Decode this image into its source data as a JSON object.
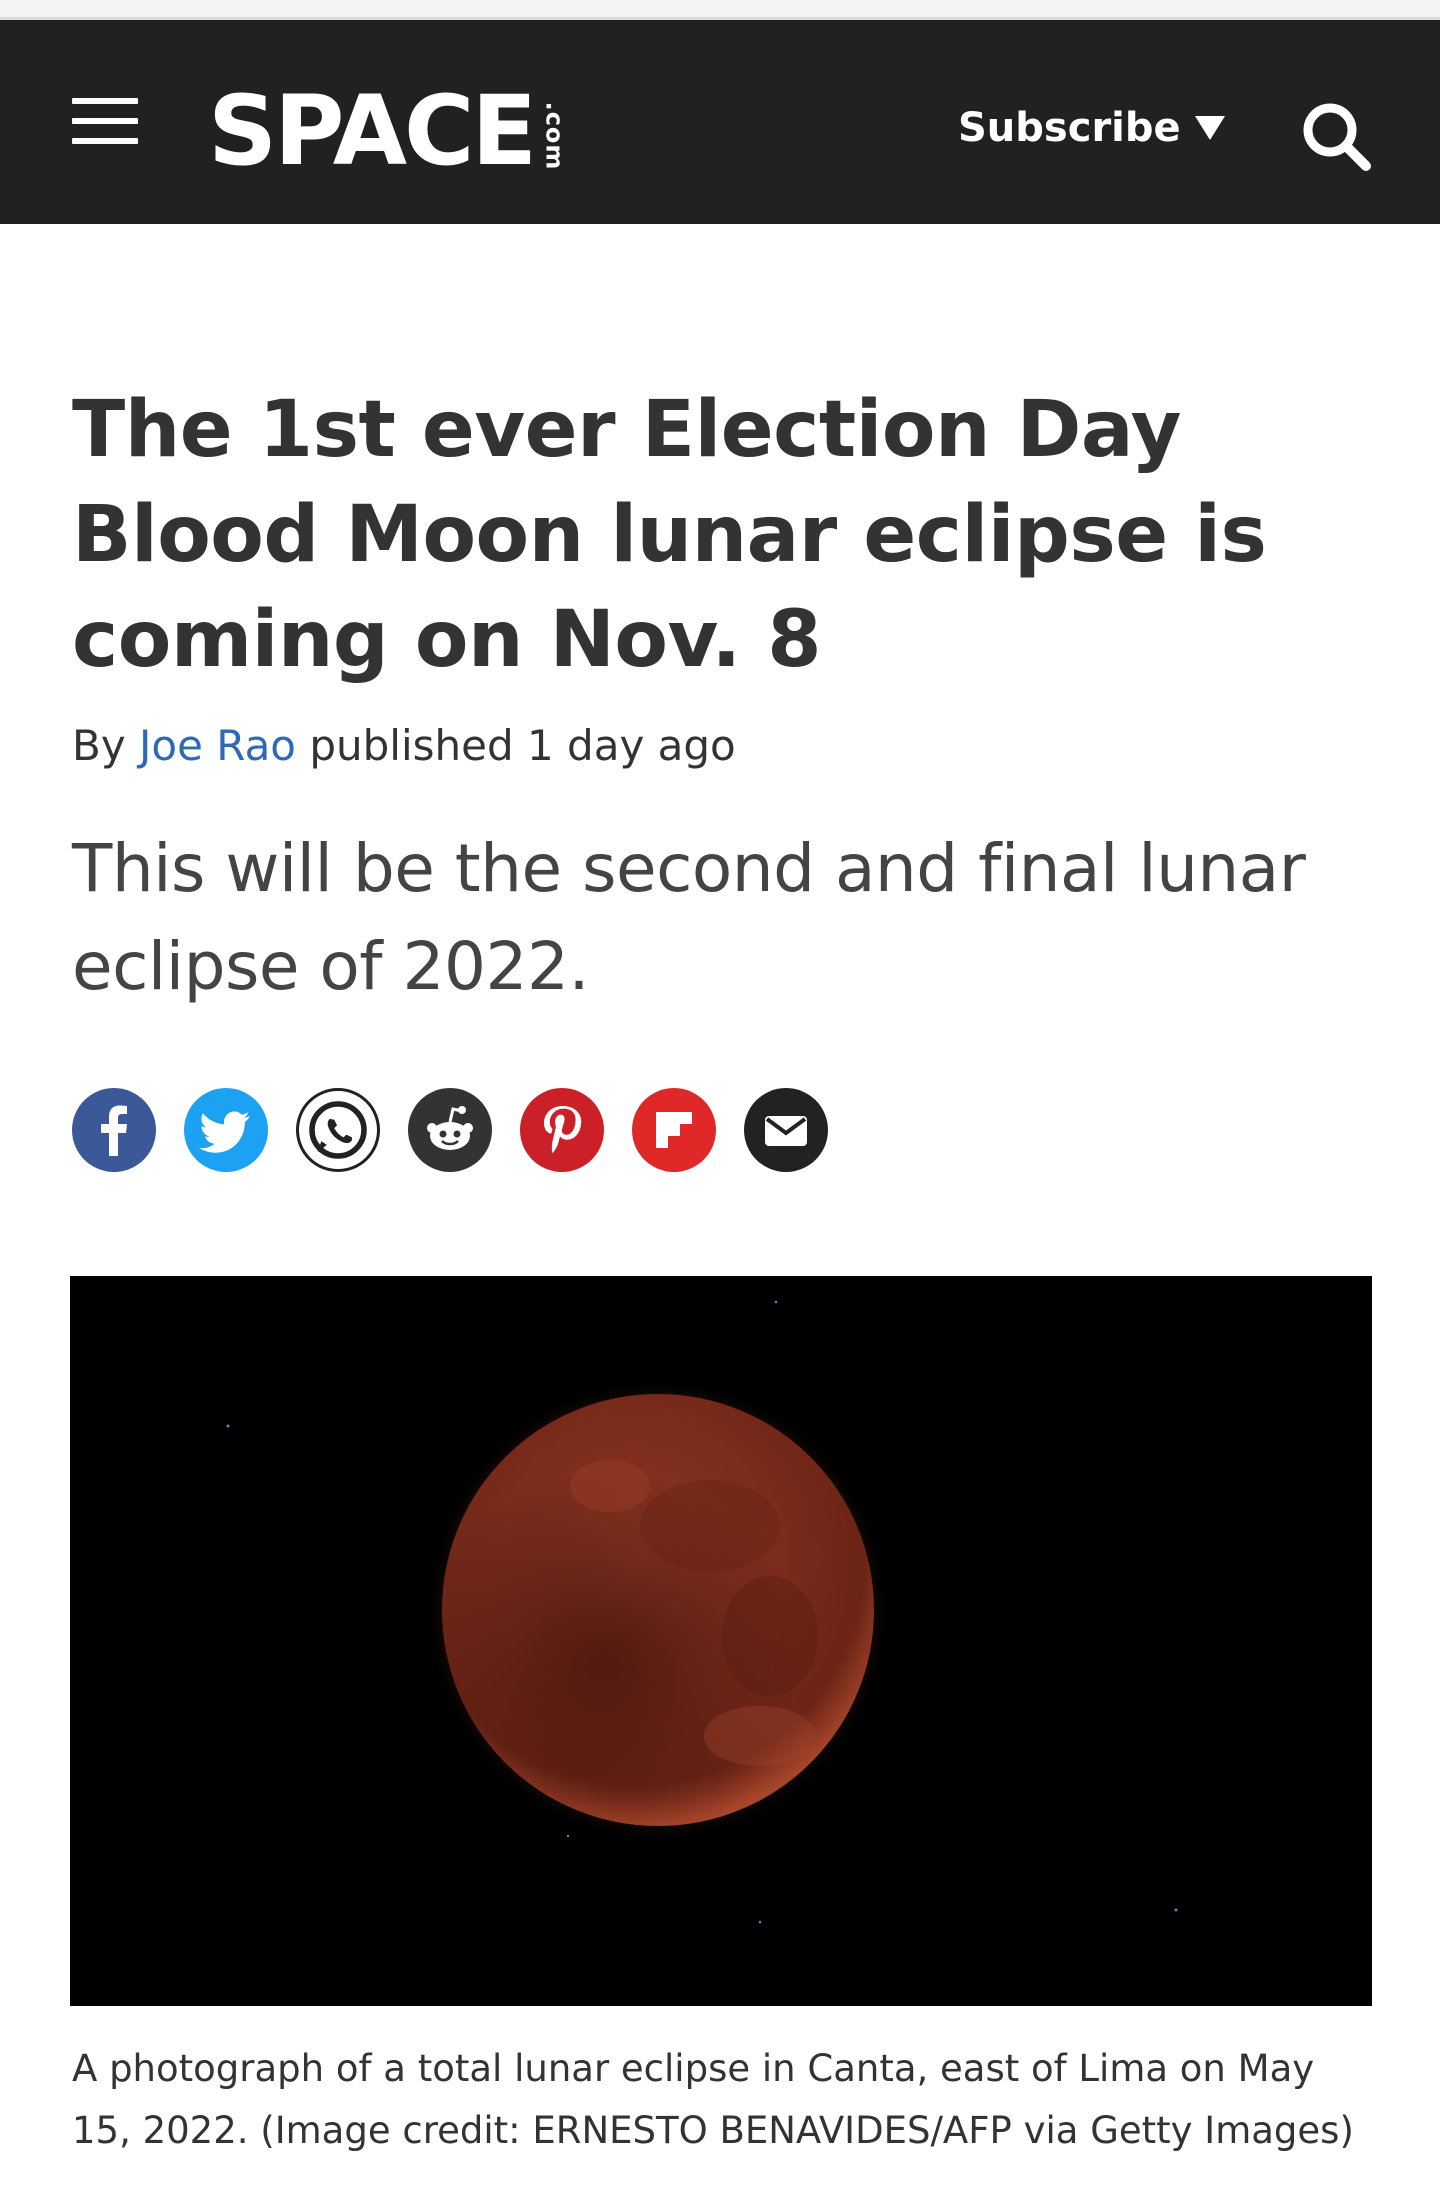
{
  "header": {
    "menu_icon": "hamburger-menu-icon",
    "logo_text": "SPACE",
    "logo_suffix": ".com",
    "subscribe_label": "Subscribe",
    "search_icon": "search-icon",
    "background": "#212121"
  },
  "article": {
    "headline": "The 1st ever Election Day Blood Moon lunar eclipse is coming on Nov. 8",
    "byline_prefix": "By",
    "author": "Joe Rao",
    "published": "published 1 day ago",
    "standfirst": "This will be the second and final lunar eclipse of 2022.",
    "share_buttons": [
      {
        "icon": "facebook-icon",
        "color": "#3b5998"
      },
      {
        "icon": "twitter-icon",
        "color": "#1da1f2"
      },
      {
        "icon": "whatsapp-icon",
        "color": "#ffffff"
      },
      {
        "icon": "reddit-icon",
        "color": "#333333"
      },
      {
        "icon": "pinterest-icon",
        "color": "#cb2027"
      },
      {
        "icon": "flipboard-icon",
        "color": "#e12828"
      },
      {
        "icon": "email-icon",
        "color": "#222222"
      }
    ],
    "caption": "A photograph of a total lunar eclipse in Canta, east of Lima on May 15, 2022.",
    "credit": "(Image credit: ERNESTO BENAVIDES/AFP via Getty Images)"
  },
  "colors": {
    "link": "#2f69b5",
    "text": "#333333"
  }
}
